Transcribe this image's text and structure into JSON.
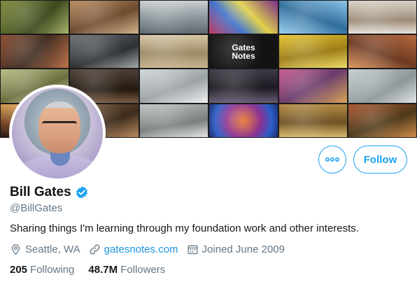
{
  "banner": {
    "gates_notes_line1": "Gates",
    "gates_notes_line2": "Notes"
  },
  "profile": {
    "name": "Bill Gates",
    "handle": "@BillGates",
    "verified": true,
    "bio": "Sharing things I'm learning through my foundation work and other interests.",
    "location": "Seattle, WA",
    "website": "gatesnotes.com",
    "joined": "Joined June 2009"
  },
  "actions": {
    "follow_label": "Follow",
    "more_icon": "more-dots-icon"
  },
  "stats": {
    "following_count": "205",
    "following_label": "Following",
    "followers_count": "48.7M",
    "followers_label": "Followers"
  },
  "colors": {
    "accent": "#1da1f2",
    "link": "#1b95e0",
    "secondary_text": "#657786",
    "primary_text": "#14171a"
  }
}
